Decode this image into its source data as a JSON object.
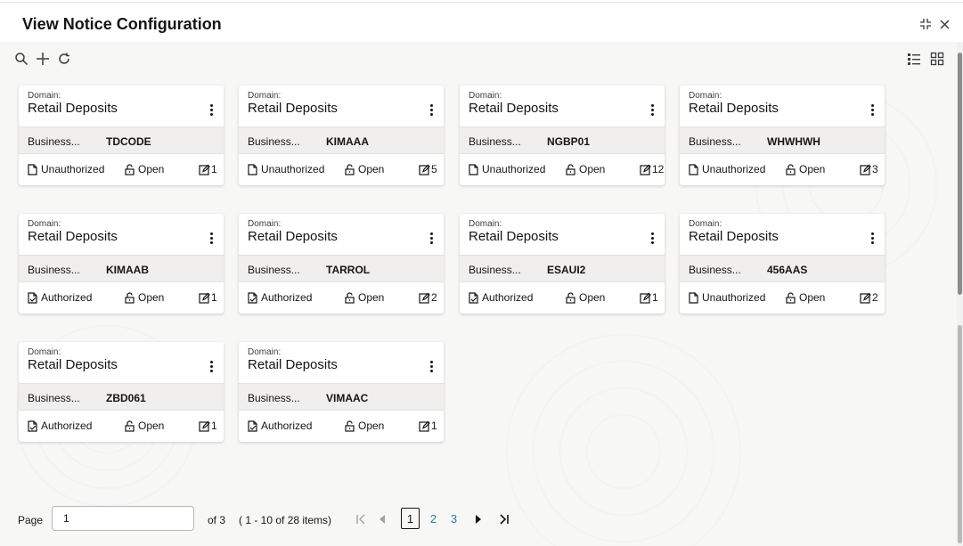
{
  "header": {
    "title": "View Notice Configuration"
  },
  "icons": {
    "minimize": "compress-icon",
    "close": "close-icon",
    "search": "search-icon",
    "add": "plus-icon",
    "refresh": "refresh-icon",
    "list_view": "list-view-icon",
    "grid_view": "grid-view-icon"
  },
  "colors": {
    "accent": "#227e9e",
    "band": "#f0efee",
    "background": "#f7f7f6"
  },
  "cards": [
    {
      "domain_label": "Domain:",
      "domain": "Retail Deposits",
      "business_label": "Business...",
      "business_code": "TDCODE",
      "status": "Unauthorized",
      "status_icon": "document-icon",
      "lock": "Open",
      "mod_count": "1"
    },
    {
      "domain_label": "Domain:",
      "domain": "Retail Deposits",
      "business_label": "Business...",
      "business_code": "KIMAAA",
      "status": "Unauthorized",
      "status_icon": "document-icon",
      "lock": "Open",
      "mod_count": "5"
    },
    {
      "domain_label": "Domain:",
      "domain": "Retail Deposits",
      "business_label": "Business...",
      "business_code": "NGBP01",
      "status": "Unauthorized",
      "status_icon": "document-icon",
      "lock": "Open",
      "mod_count": "12"
    },
    {
      "domain_label": "Domain:",
      "domain": "Retail Deposits",
      "business_label": "Business...",
      "business_code": "WHWHWH",
      "status": "Unauthorized",
      "status_icon": "document-icon",
      "lock": "Open",
      "mod_count": "3"
    },
    {
      "domain_label": "Domain:",
      "domain": "Retail Deposits",
      "business_label": "Business...",
      "business_code": "KIMAAB",
      "status": "Authorized",
      "status_icon": "document-check-icon",
      "lock": "Open",
      "mod_count": "1"
    },
    {
      "domain_label": "Domain:",
      "domain": "Retail Deposits",
      "business_label": "Business...",
      "business_code": "TARROL",
      "status": "Authorized",
      "status_icon": "document-check-icon",
      "lock": "Open",
      "mod_count": "2"
    },
    {
      "domain_label": "Domain:",
      "domain": "Retail Deposits",
      "business_label": "Business...",
      "business_code": "ESAUI2",
      "status": "Authorized",
      "status_icon": "document-check-icon",
      "lock": "Open",
      "mod_count": "1"
    },
    {
      "domain_label": "Domain:",
      "domain": "Retail Deposits",
      "business_label": "Business...",
      "business_code": "456AAS",
      "status": "Unauthorized",
      "status_icon": "document-icon",
      "lock": "Open",
      "mod_count": "2"
    },
    {
      "domain_label": "Domain:",
      "domain": "Retail Deposits",
      "business_label": "Business...",
      "business_code": "ZBD061",
      "status": "Authorized",
      "status_icon": "document-check-icon",
      "lock": "Open",
      "mod_count": "1"
    },
    {
      "domain_label": "Domain:",
      "domain": "Retail Deposits",
      "business_label": "Business...",
      "business_code": "VIMAAC",
      "status": "Authorized",
      "status_icon": "document-check-icon",
      "lock": "Open",
      "mod_count": "1"
    }
  ],
  "pagination": {
    "page_label": "Page",
    "page_value": "1",
    "of_text": "of 3",
    "range_text": "( 1 - 10 of 28 items)",
    "pages": [
      "1",
      "2",
      "3"
    ],
    "current_page": "1"
  }
}
